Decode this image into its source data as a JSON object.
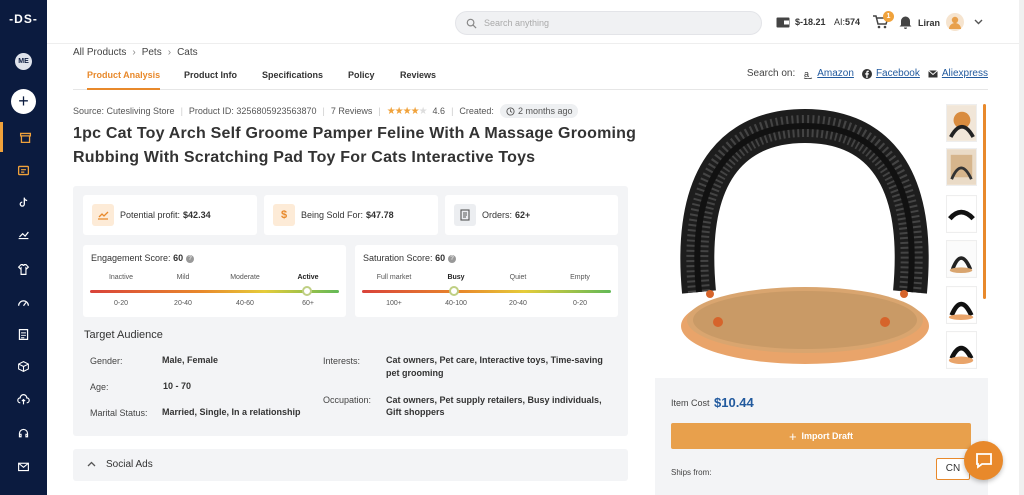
{
  "sidebar": {
    "logo": "-DS-",
    "avatar": "ME",
    "items": [
      "store-icon",
      "orders-icon",
      "tiktok-icon",
      "chart-icon",
      "shirt-icon",
      "gauge-icon",
      "document-icon",
      "box-icon",
      "upload-icon",
      "support-icon",
      "mail-icon"
    ]
  },
  "topbar": {
    "search_placeholder": "Search anything",
    "balance": "$-18.21",
    "ai_label": "AI:",
    "ai_count": "574",
    "cart_badge": "1",
    "username": "Liran"
  },
  "breadcrumb": [
    "All Products",
    "Pets",
    "Cats"
  ],
  "tabs": [
    "Product Analysis",
    "Product Info",
    "Specifications",
    "Policy",
    "Reviews"
  ],
  "search_on": {
    "label": "Search on:",
    "links": [
      "Amazon",
      "Facebook",
      "Aliexpress"
    ]
  },
  "meta": {
    "source": "Source: Cutesliving Store",
    "product_id": "Product ID: 3256805923563870",
    "reviews": "7 Reviews",
    "rating": 4.6,
    "rating_text": "4.6",
    "created_label": "Created:",
    "created_value": "2 months ago"
  },
  "title": "1pc Cat Toy Arch Self Groome Pamper Feline With A Massage Grooming Rubbing With Scratching Pad Toy For Cats Interactive Toys",
  "stats": {
    "profit_label": "Potential profit:",
    "profit_value": "$42.34",
    "sold_label": "Being Sold For:",
    "sold_value": "$47.78",
    "orders_label": "Orders:",
    "orders_value": "62+"
  },
  "engagement": {
    "label": "Engagement Score:",
    "value": "60",
    "levels": [
      "Inactive",
      "Mild",
      "Moderate",
      "Active"
    ],
    "ranges": [
      "0-20",
      "20-40",
      "40-60",
      "60+"
    ],
    "active_index": 3,
    "position": 0.87
  },
  "saturation": {
    "label": "Saturation Score:",
    "value": "60",
    "levels": [
      "Full market",
      "Busy",
      "Quiet",
      "Empty"
    ],
    "ranges": [
      "100+",
      "40-100",
      "20-40",
      "0-20"
    ],
    "active_index": 1,
    "position": 0.37
  },
  "audience": {
    "title": "Target Audience",
    "gender_label": "Gender:",
    "gender": "Male, Female",
    "age_label": "Age:",
    "age": "10 - 70",
    "marital_label": "Marital Status:",
    "marital": "Married, Single, In a relationship",
    "interests_label": "Interests:",
    "interests_1": "Cat owners, Pet care, Interactive toys, Time-saving",
    "interests_2": "pet grooming",
    "occupation_label": "Occupation:",
    "occupation_1": "Cat owners, Pet supply retailers, Busy individuals,",
    "occupation_2": "Gift shoppers"
  },
  "social": {
    "label": "Social Ads"
  },
  "cost": {
    "label": "Item Cost",
    "value": "$10.44",
    "import_label": "Import Draft",
    "ships_label": "Ships from:",
    "ships_country": "CN"
  },
  "colors": {
    "accent": "#e8892b",
    "sidebar": "#0b1b3f",
    "link": "#225a9e"
  }
}
